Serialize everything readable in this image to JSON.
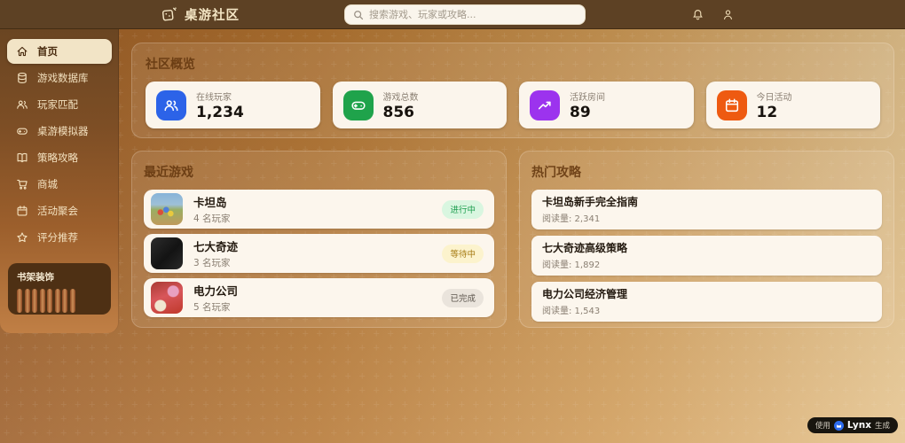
{
  "topbar": {
    "logo_text": "桌游社区",
    "search_placeholder": "搜索游戏、玩家或攻略..."
  },
  "sidebar": {
    "items": [
      {
        "label": "首页",
        "icon": "home-icon",
        "active": true
      },
      {
        "label": "游戏数据库",
        "icon": "database-icon",
        "active": false
      },
      {
        "label": "玩家匹配",
        "icon": "users-icon",
        "active": false
      },
      {
        "label": "桌游模拟器",
        "icon": "gamepad-icon",
        "active": false
      },
      {
        "label": "策略攻略",
        "icon": "book-icon",
        "active": false
      },
      {
        "label": "商城",
        "icon": "cart-icon",
        "active": false
      },
      {
        "label": "活动聚会",
        "icon": "calendar-icon",
        "active": false
      },
      {
        "label": "评分推荐",
        "icon": "star-icon",
        "active": false
      }
    ],
    "bookshelf": {
      "title": "书架装饰",
      "bar_count": 8
    }
  },
  "overview": {
    "title": "社区概览",
    "stats": [
      {
        "label": "在线玩家",
        "value": "1,234",
        "icon": "users-icon",
        "color": "#2c63e8"
      },
      {
        "label": "游戏总数",
        "value": "856",
        "icon": "gamepad-icon",
        "color": "#1fa34b"
      },
      {
        "label": "活跃房间",
        "value": "89",
        "icon": "trending-up-icon",
        "color": "#9c33ee"
      },
      {
        "label": "今日活动",
        "value": "12",
        "icon": "calendar-icon",
        "color": "#ee5a11"
      }
    ]
  },
  "recent_games": {
    "title": "最近游戏",
    "games": [
      {
        "name": "卡坦岛",
        "players": "4 名玩家",
        "status": "进行中",
        "status_type": "active"
      },
      {
        "name": "七大奇迹",
        "players": "3 名玩家",
        "status": "等待中",
        "status_type": "waiting"
      },
      {
        "name": "电力公司",
        "players": "5 名玩家",
        "status": "已完成",
        "status_type": "done"
      }
    ]
  },
  "hot_guides": {
    "title": "热门攻略",
    "guides": [
      {
        "title": "卡坦岛新手完全指南",
        "views": "阅读量: 2,341"
      },
      {
        "title": "七大奇迹高级策略",
        "views": "阅读量: 1,892"
      },
      {
        "title": "电力公司经济管理",
        "views": "阅读量: 1,543"
      }
    ]
  },
  "footer_badge": {
    "prefix": "使用",
    "brand": "Lynx",
    "suffix": "生成"
  }
}
